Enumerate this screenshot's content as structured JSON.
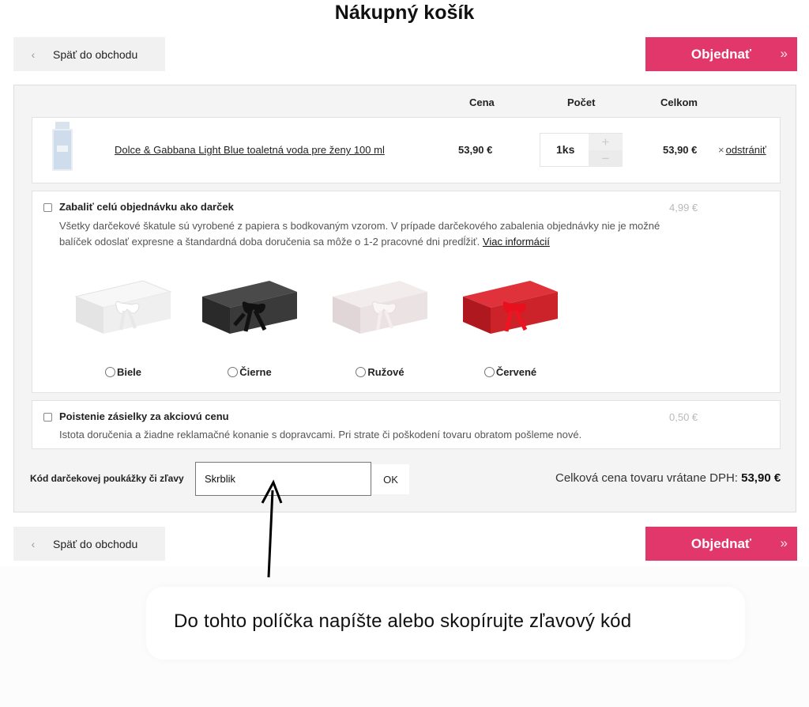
{
  "page": {
    "title": "Nákupný košík"
  },
  "nav": {
    "back_label": "Späť do obchodu",
    "order_label": "Objednať",
    "back_icon": "‹",
    "order_icon": "»"
  },
  "cart": {
    "columns": {
      "price": "Cena",
      "qty": "Počet",
      "total": "Celkom"
    },
    "items": [
      {
        "name": "Dolce & Gabbana Light Blue toaletná voda pre ženy 100 ml",
        "price": "53,90 €",
        "qty": "1ks",
        "total": "53,90 €",
        "remove_label": "odstrániť"
      }
    ]
  },
  "gift": {
    "title": "Zabaliť celú objednávku ako darček",
    "price": "4,99 €",
    "desc_line1": "Všetky darčekové škatule sú vyrobené z papiera s bodkovaným vzorom. V prípade darčekového zabalenia objednávky nie je možné",
    "desc_line2": "balíček odoslať expresne a štandardná doba doručenia sa môže o 1-2 pracovné dni predĺžiť.",
    "more_link": "Viac informácií",
    "options": [
      {
        "label": "Biele",
        "color": "#eeeeee"
      },
      {
        "label": "Čierne",
        "color": "#3a3a3a"
      },
      {
        "label": "Ružové",
        "color": "#ece4e6"
      },
      {
        "label": "Červené",
        "color": "#d4222c"
      }
    ]
  },
  "insurance": {
    "title": "Poistenie zásielky za akciovú cenu",
    "price": "0,50 €",
    "desc": "Istota doručenia a žiadne reklamačné konanie s dopravcami. Pri strate či poškodení tovaru obratom pošleme nové."
  },
  "coupon": {
    "label": "Kód darčekovej poukážky či zľavy",
    "value": "Skrblik",
    "ok_label": "OK"
  },
  "summary": {
    "total_label": "Celková cena tovaru vrátane DPH:",
    "total_value": "53,90 €"
  },
  "annotation": {
    "text": "Do tohto políčka napíšte alebo skopírujte zľavový kód"
  },
  "colors": {
    "accent": "#e2376a",
    "panel": "#f4f4f4"
  }
}
